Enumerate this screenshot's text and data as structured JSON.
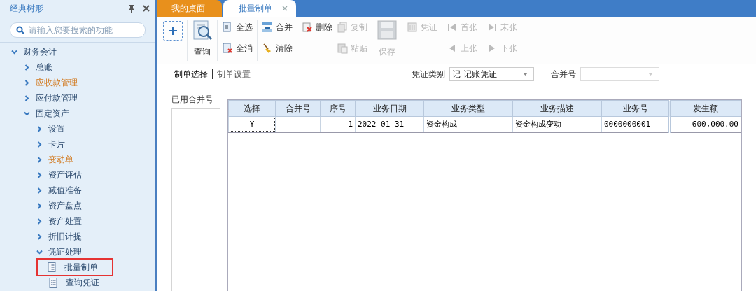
{
  "sidebar": {
    "title": "经典树形",
    "search": {
      "placeholder": "请输入您要搜索的功能"
    },
    "tree": [
      {
        "label": "财务会计",
        "kind": "folder",
        "expanded": true,
        "highlighted": false,
        "selected": false,
        "children": [
          {
            "label": "总账",
            "kind": "folder",
            "expanded": false,
            "highlighted": false,
            "selected": false
          },
          {
            "label": "应收款管理",
            "kind": "folder",
            "expanded": false,
            "highlighted": true,
            "selected": false
          },
          {
            "label": "应付款管理",
            "kind": "folder",
            "expanded": false,
            "highlighted": false,
            "selected": false
          },
          {
            "label": "固定资产",
            "kind": "folder",
            "expanded": true,
            "highlighted": false,
            "selected": false,
            "children": [
              {
                "label": "设置",
                "kind": "folder",
                "expanded": false,
                "highlighted": false,
                "selected": false
              },
              {
                "label": "卡片",
                "kind": "folder",
                "expanded": false,
                "highlighted": false,
                "selected": false
              },
              {
                "label": "变动单",
                "kind": "folder",
                "expanded": false,
                "highlighted": true,
                "selected": false
              },
              {
                "label": "资产评估",
                "kind": "folder",
                "expanded": false,
                "highlighted": false,
                "selected": false
              },
              {
                "label": "减值准备",
                "kind": "folder",
                "expanded": false,
                "highlighted": false,
                "selected": false
              },
              {
                "label": "资产盘点",
                "kind": "folder",
                "expanded": false,
                "highlighted": false,
                "selected": false
              },
              {
                "label": "资产处置",
                "kind": "folder",
                "expanded": false,
                "highlighted": false,
                "selected": false
              },
              {
                "label": "折旧计提",
                "kind": "folder",
                "expanded": false,
                "highlighted": false,
                "selected": false
              },
              {
                "label": "凭证处理",
                "kind": "folder",
                "expanded": true,
                "highlighted": false,
                "selected": false,
                "children": [
                  {
                    "label": "批量制单",
                    "kind": "document",
                    "highlighted": false,
                    "selected": true
                  },
                  {
                    "label": "查询凭证",
                    "kind": "document",
                    "highlighted": false,
                    "selected": false
                  }
                ]
              }
            ]
          }
        ]
      }
    ]
  },
  "tabs": [
    {
      "label": "我的桌面",
      "selected": false,
      "closable": false
    },
    {
      "label": "批量制单",
      "selected": true,
      "closable": true
    }
  ],
  "toolbar": {
    "groups": [
      {
        "kind": "big",
        "items": [
          {
            "label": "查询",
            "disabled": false
          }
        ]
      },
      {
        "kind": "small",
        "items": [
          {
            "label": "全选",
            "disabled": false
          },
          {
            "label": "全消",
            "disabled": false
          }
        ]
      },
      {
        "kind": "small",
        "items": [
          {
            "label": "合并",
            "disabled": false
          },
          {
            "label": "清除",
            "disabled": false
          }
        ]
      },
      {
        "kind": "small",
        "items": [
          {
            "label": "删除",
            "disabled": false
          }
        ]
      },
      {
        "kind": "joined",
        "items": [
          {
            "label": "复制",
            "disabled": true
          },
          {
            "label": "粘贴",
            "disabled": true
          }
        ]
      },
      {
        "kind": "big",
        "items": [
          {
            "label": "保存",
            "disabled": true
          }
        ]
      },
      {
        "kind": "small",
        "items": [
          {
            "label": "凭证",
            "disabled": true
          }
        ]
      },
      {
        "kind": "small",
        "items": [
          {
            "label": "首张",
            "disabled": true
          },
          {
            "label": "上张",
            "disabled": true
          }
        ]
      },
      {
        "kind": "small",
        "items": [
          {
            "label": "末张",
            "disabled": true
          },
          {
            "label": "下张",
            "disabled": true
          }
        ]
      }
    ]
  },
  "subtabs": [
    {
      "label": "制单选择",
      "selected": true
    },
    {
      "label": "制单设置",
      "selected": false
    }
  ],
  "filters": {
    "voucher_type": {
      "label": "凭证类别",
      "value": "记 记账凭证",
      "disabled": false
    },
    "merge_no": {
      "label": "合并号",
      "disabled": true
    }
  },
  "used_merge": {
    "label": "已用合并号"
  },
  "table": {
    "columns": [
      "选择",
      "合并号",
      "序号",
      "业务日期",
      "业务类型",
      "业务描述",
      "业务号",
      "发生额"
    ],
    "rows": [
      {
        "cells": [
          "Y",
          "",
          "1",
          "2022-01-31",
          "资金构成",
          "资金构成变动",
          "0000000001",
          "600,000.00"
        ],
        "focused": true
      }
    ]
  }
}
